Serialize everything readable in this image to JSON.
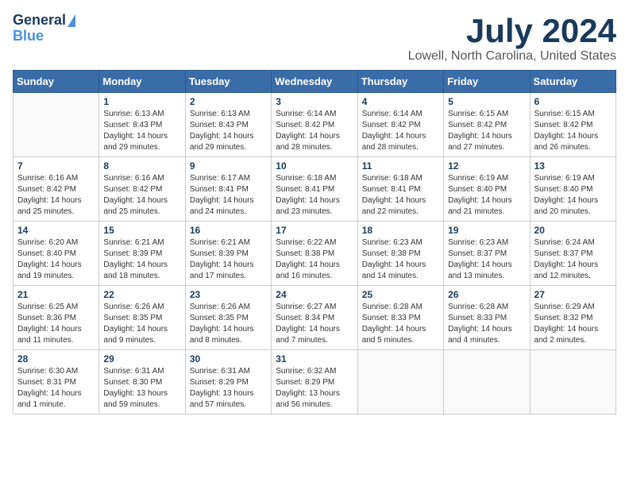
{
  "header": {
    "logo_line1": "General",
    "logo_line2": "Blue",
    "month": "July 2024",
    "location": "Lowell, North Carolina, United States"
  },
  "weekdays": [
    "Sunday",
    "Monday",
    "Tuesday",
    "Wednesday",
    "Thursday",
    "Friday",
    "Saturday"
  ],
  "weeks": [
    [
      {
        "day": "",
        "info": ""
      },
      {
        "day": "1",
        "info": "Sunrise: 6:13 AM\nSunset: 8:43 PM\nDaylight: 14 hours\nand 29 minutes."
      },
      {
        "day": "2",
        "info": "Sunrise: 6:13 AM\nSunset: 8:43 PM\nDaylight: 14 hours\nand 29 minutes."
      },
      {
        "day": "3",
        "info": "Sunrise: 6:14 AM\nSunset: 8:42 PM\nDaylight: 14 hours\nand 28 minutes."
      },
      {
        "day": "4",
        "info": "Sunrise: 6:14 AM\nSunset: 8:42 PM\nDaylight: 14 hours\nand 28 minutes."
      },
      {
        "day": "5",
        "info": "Sunrise: 6:15 AM\nSunset: 8:42 PM\nDaylight: 14 hours\nand 27 minutes."
      },
      {
        "day": "6",
        "info": "Sunrise: 6:15 AM\nSunset: 8:42 PM\nDaylight: 14 hours\nand 26 minutes."
      }
    ],
    [
      {
        "day": "7",
        "info": "Sunrise: 6:16 AM\nSunset: 8:42 PM\nDaylight: 14 hours\nand 25 minutes."
      },
      {
        "day": "8",
        "info": "Sunrise: 6:16 AM\nSunset: 8:42 PM\nDaylight: 14 hours\nand 25 minutes."
      },
      {
        "day": "9",
        "info": "Sunrise: 6:17 AM\nSunset: 8:41 PM\nDaylight: 14 hours\nand 24 minutes."
      },
      {
        "day": "10",
        "info": "Sunrise: 6:18 AM\nSunset: 8:41 PM\nDaylight: 14 hours\nand 23 minutes."
      },
      {
        "day": "11",
        "info": "Sunrise: 6:18 AM\nSunset: 8:41 PM\nDaylight: 14 hours\nand 22 minutes."
      },
      {
        "day": "12",
        "info": "Sunrise: 6:19 AM\nSunset: 8:40 PM\nDaylight: 14 hours\nand 21 minutes."
      },
      {
        "day": "13",
        "info": "Sunrise: 6:19 AM\nSunset: 8:40 PM\nDaylight: 14 hours\nand 20 minutes."
      }
    ],
    [
      {
        "day": "14",
        "info": "Sunrise: 6:20 AM\nSunset: 8:40 PM\nDaylight: 14 hours\nand 19 minutes."
      },
      {
        "day": "15",
        "info": "Sunrise: 6:21 AM\nSunset: 8:39 PM\nDaylight: 14 hours\nand 18 minutes."
      },
      {
        "day": "16",
        "info": "Sunrise: 6:21 AM\nSunset: 8:39 PM\nDaylight: 14 hours\nand 17 minutes."
      },
      {
        "day": "17",
        "info": "Sunrise: 6:22 AM\nSunset: 8:38 PM\nDaylight: 14 hours\nand 16 minutes."
      },
      {
        "day": "18",
        "info": "Sunrise: 6:23 AM\nSunset: 8:38 PM\nDaylight: 14 hours\nand 14 minutes."
      },
      {
        "day": "19",
        "info": "Sunrise: 6:23 AM\nSunset: 8:37 PM\nDaylight: 14 hours\nand 13 minutes."
      },
      {
        "day": "20",
        "info": "Sunrise: 6:24 AM\nSunset: 8:37 PM\nDaylight: 14 hours\nand 12 minutes."
      }
    ],
    [
      {
        "day": "21",
        "info": "Sunrise: 6:25 AM\nSunset: 8:36 PM\nDaylight: 14 hours\nand 11 minutes."
      },
      {
        "day": "22",
        "info": "Sunrise: 6:26 AM\nSunset: 8:35 PM\nDaylight: 14 hours\nand 9 minutes."
      },
      {
        "day": "23",
        "info": "Sunrise: 6:26 AM\nSunset: 8:35 PM\nDaylight: 14 hours\nand 8 minutes."
      },
      {
        "day": "24",
        "info": "Sunrise: 6:27 AM\nSunset: 8:34 PM\nDaylight: 14 hours\nand 7 minutes."
      },
      {
        "day": "25",
        "info": "Sunrise: 6:28 AM\nSunset: 8:33 PM\nDaylight: 14 hours\nand 5 minutes."
      },
      {
        "day": "26",
        "info": "Sunrise: 6:28 AM\nSunset: 8:33 PM\nDaylight: 14 hours\nand 4 minutes."
      },
      {
        "day": "27",
        "info": "Sunrise: 6:29 AM\nSunset: 8:32 PM\nDaylight: 14 hours\nand 2 minutes."
      }
    ],
    [
      {
        "day": "28",
        "info": "Sunrise: 6:30 AM\nSunset: 8:31 PM\nDaylight: 14 hours\nand 1 minute."
      },
      {
        "day": "29",
        "info": "Sunrise: 6:31 AM\nSunset: 8:30 PM\nDaylight: 13 hours\nand 59 minutes."
      },
      {
        "day": "30",
        "info": "Sunrise: 6:31 AM\nSunset: 8:29 PM\nDaylight: 13 hours\nand 57 minutes."
      },
      {
        "day": "31",
        "info": "Sunrise: 6:32 AM\nSunset: 8:29 PM\nDaylight: 13 hours\nand 56 minutes."
      },
      {
        "day": "",
        "info": ""
      },
      {
        "day": "",
        "info": ""
      },
      {
        "day": "",
        "info": ""
      }
    ]
  ]
}
